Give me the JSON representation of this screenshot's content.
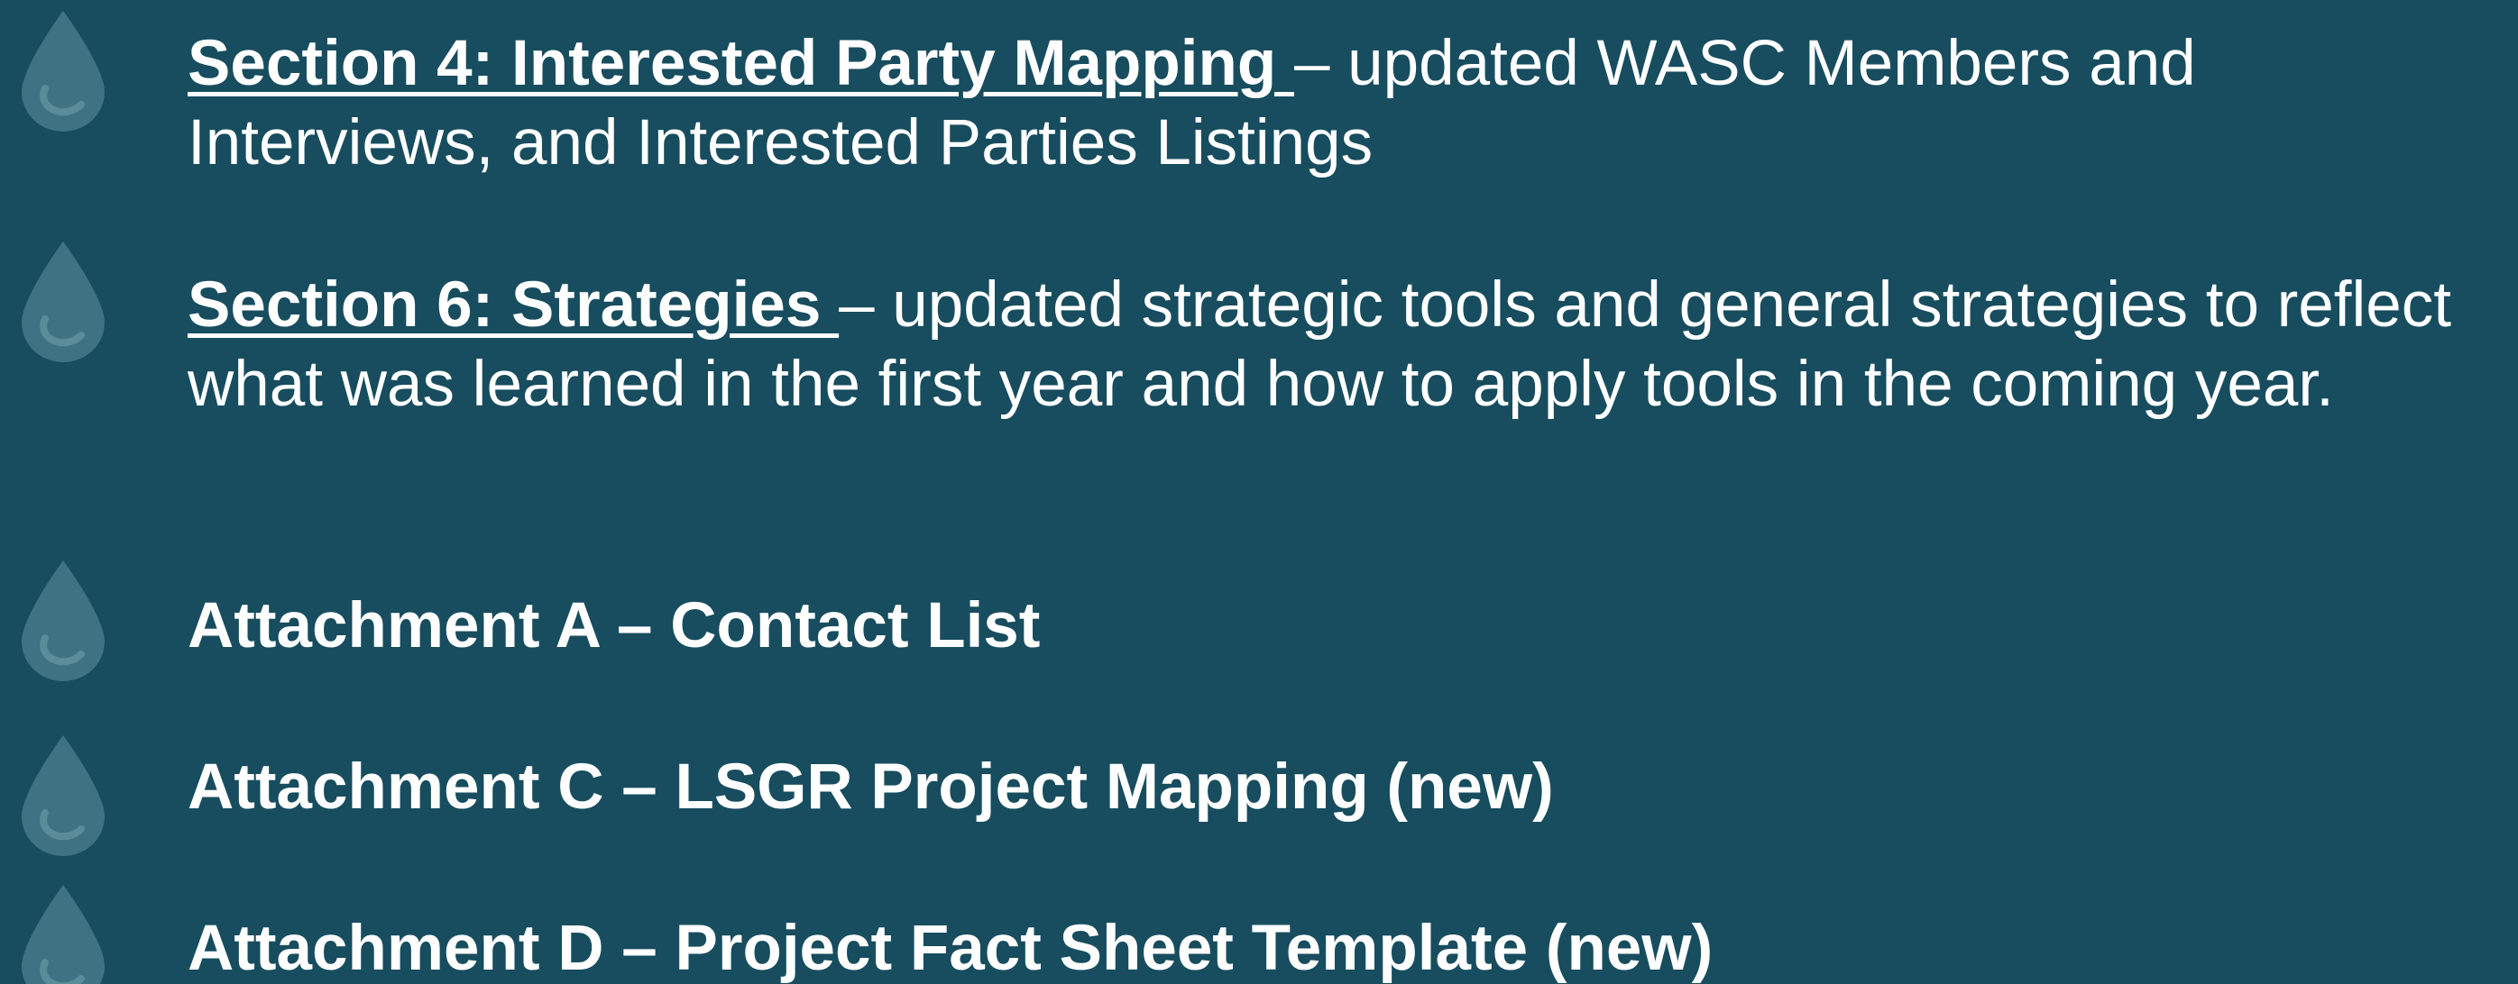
{
  "bullets": [
    {
      "heading": "Section 4: Interested Party Mapping ",
      "text": "– updated WASC Members and Interviews, and Interested Parties Listings"
    },
    {
      "heading": "Section 6: Strategies ",
      "text": "– updated strategic tools and general strategies to reflect what was learned in the first year and how to apply tools in the coming year."
    },
    {
      "heading": "Attachment A – Contact List"
    },
    {
      "heading": "Attachment C – LSGR Project Mapping (new)"
    },
    {
      "heading": "Attachment D – Project Fact Sheet Template (new)"
    }
  ],
  "icon": "water-drop-icon",
  "colors": {
    "background": "#174d5e",
    "text": "#ffffff",
    "icon": "#3f7282"
  }
}
